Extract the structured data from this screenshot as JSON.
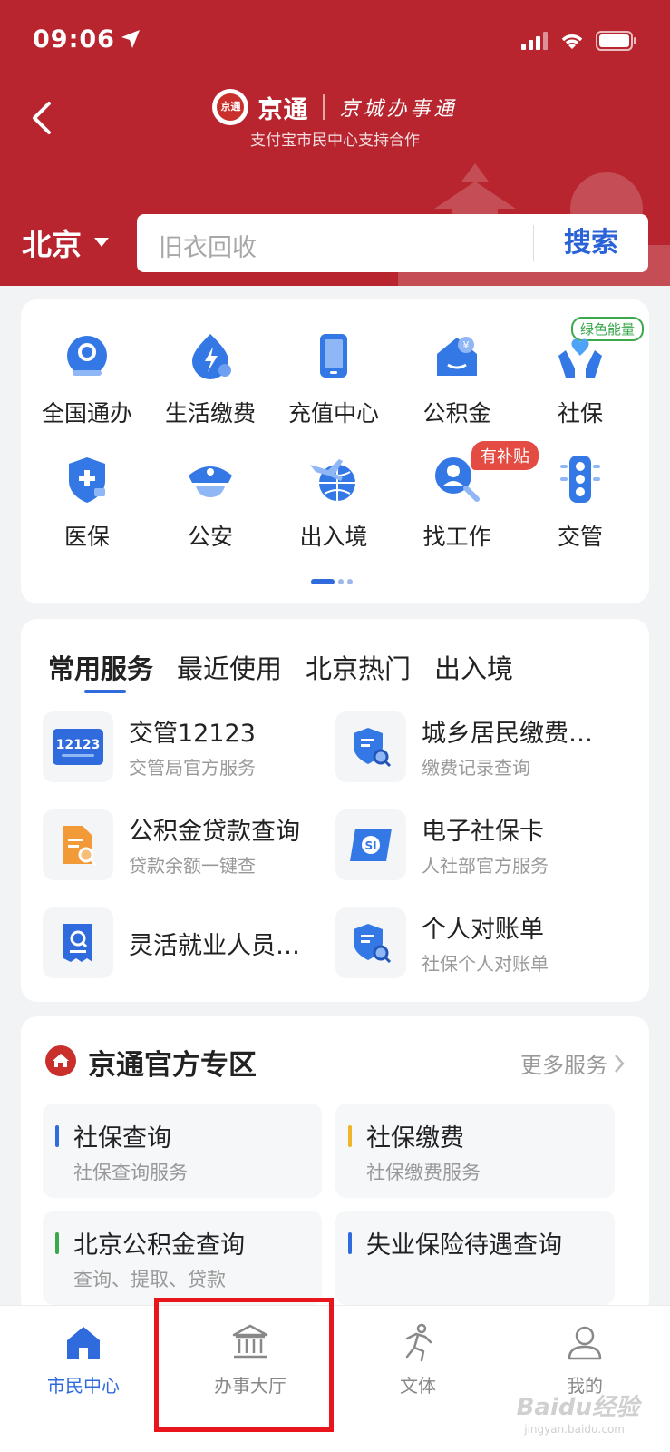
{
  "status_bar": {
    "time": "09:06"
  },
  "header": {
    "brand": "京通",
    "brand_badge": "京通",
    "brand_script": "京城办事通",
    "subtitle": "支付宝市民中心支持合作",
    "city": "北京",
    "search_placeholder": "旧衣回收",
    "search_button": "搜索"
  },
  "grid": {
    "items": [
      {
        "label": "全国通办",
        "icon": "globe-service-icon"
      },
      {
        "label": "生活缴费",
        "icon": "lightning-icon"
      },
      {
        "label": "充值中心",
        "icon": "tablet-icon"
      },
      {
        "label": "公积金",
        "icon": "house-fund-icon"
      },
      {
        "label": "社保",
        "icon": "hands-heart-icon"
      },
      {
        "label": "医保",
        "icon": "medical-shield-icon"
      },
      {
        "label": "公安",
        "icon": "police-cap-icon"
      },
      {
        "label": "出入境",
        "icon": "plane-globe-icon"
      },
      {
        "label": "找工作",
        "icon": "job-search-icon"
      },
      {
        "label": "交管",
        "icon": "traffic-light-icon"
      }
    ],
    "tag_green": "绿色能量",
    "tag_red": "有补贴"
  },
  "services": {
    "tabs": [
      "常用服务",
      "最近使用",
      "北京热门",
      "出入境"
    ],
    "items": [
      {
        "title": "交管12123",
        "subtitle": "交管局官方服务",
        "icon_text": "12123"
      },
      {
        "title": "城乡居民缴费…",
        "subtitle": "缴费记录查询"
      },
      {
        "title": "公积金贷款查询",
        "subtitle": "贷款余额一键查"
      },
      {
        "title": "电子社保卡",
        "subtitle": "人社部官方服务"
      },
      {
        "title": "灵活就业人员…",
        "subtitle": ""
      },
      {
        "title": "个人对账单",
        "subtitle": "社保个人对账单"
      }
    ]
  },
  "official": {
    "title": "京通官方专区",
    "more": "更多服务",
    "items": [
      {
        "title": "社保查询",
        "subtitle": "社保查询服务",
        "color": "#2f6bdc"
      },
      {
        "title": "社保缴费",
        "subtitle": "社保缴费服务",
        "color": "#f0b429"
      },
      {
        "title": "北京公积金查询",
        "subtitle": "查询、提取、贷款",
        "color": "#3aa84b"
      },
      {
        "title": "失业保险待遇查询",
        "subtitle": "",
        "color": "#2f6bdc"
      }
    ]
  },
  "bottom_nav": {
    "items": [
      {
        "label": "市民中心",
        "active": true
      },
      {
        "label": "办事大厅",
        "active": false
      },
      {
        "label": "文体",
        "active": false
      },
      {
        "label": "我的",
        "active": false
      }
    ]
  },
  "watermark": {
    "text": "Baidu经验",
    "sub": "jingyan.baidu.com"
  }
}
